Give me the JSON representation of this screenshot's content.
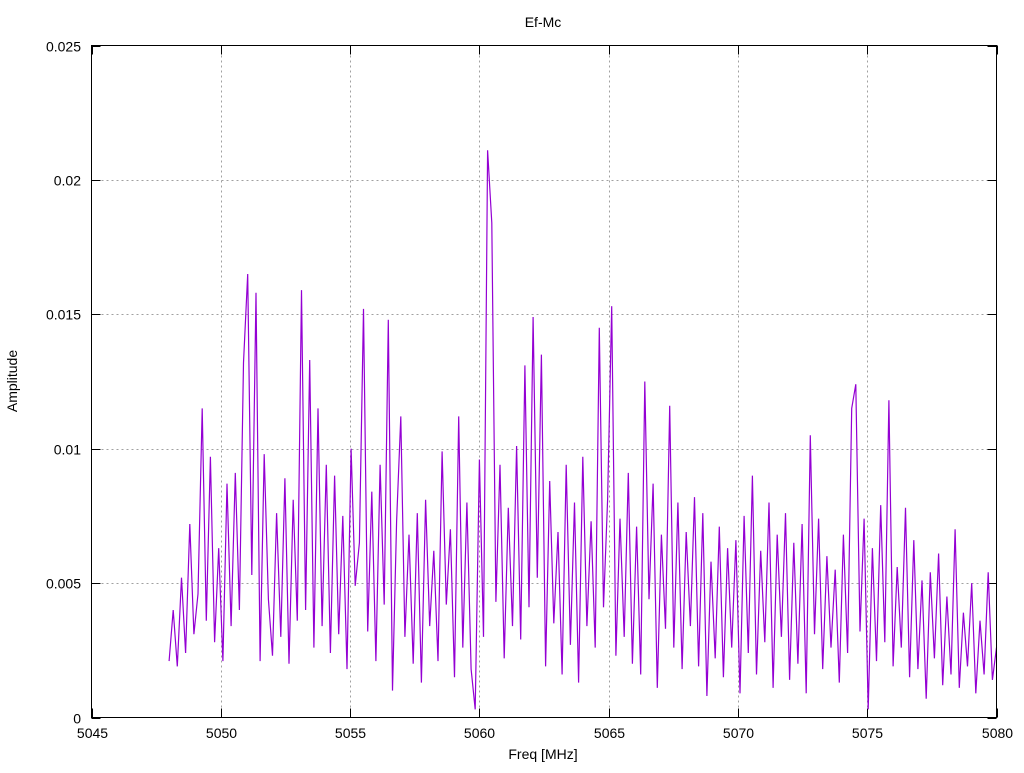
{
  "chart_data": {
    "type": "line",
    "title": "Ef-Mc",
    "xlabel": "Freq [MHz]",
    "ylabel": "Amplitude",
    "xlim": [
      5045,
      5080
    ],
    "ylim": [
      0,
      0.025
    ],
    "xticks": [
      5045,
      5050,
      5055,
      5060,
      5065,
      5070,
      5075,
      5080
    ],
    "yticks": [
      0,
      0.005,
      0.01,
      0.015,
      0.02,
      0.025
    ],
    "xtick_labels": [
      "5045",
      "5050",
      "5055",
      "5060",
      "5065",
      "5070",
      "5075",
      "5080"
    ],
    "ytick_labels": [
      "0",
      "0.005",
      "0.01",
      "0.015",
      "0.02",
      "0.025"
    ],
    "grid": true,
    "legend": "none",
    "series": [
      {
        "name": "Ef-Mc",
        "color": "#9400d3",
        "x_start": 5048.0,
        "x_step": 0.16,
        "value_multiplier": 0.001,
        "values": [
          2.1,
          4.0,
          1.9,
          5.2,
          2.4,
          7.2,
          3.1,
          4.6,
          11.5,
          3.6,
          9.7,
          2.8,
          6.3,
          2.1,
          8.7,
          3.4,
          9.1,
          4.0,
          13.2,
          16.5,
          5.3,
          15.8,
          2.1,
          9.8,
          4.4,
          2.3,
          7.6,
          3.0,
          8.9,
          2.0,
          8.1,
          3.6,
          15.9,
          4.0,
          13.3,
          2.6,
          11.5,
          3.4,
          9.4,
          2.4,
          9.0,
          3.1,
          7.5,
          1.8,
          10.0,
          4.9,
          6.5,
          15.2,
          3.2,
          8.4,
          2.1,
          9.4,
          4.2,
          14.8,
          1.0,
          7.3,
          11.2,
          3.0,
          6.8,
          2.0,
          7.6,
          1.3,
          8.1,
          3.4,
          6.2,
          2.1,
          9.9,
          4.2,
          7.0,
          1.5,
          11.2,
          2.6,
          8.0,
          1.8,
          0.3,
          9.6,
          3.0,
          21.1,
          18.4,
          4.3,
          9.4,
          2.2,
          7.8,
          3.4,
          10.1,
          2.9,
          13.1,
          4.1,
          14.9,
          5.2,
          13.5,
          1.9,
          8.8,
          3.5,
          6.9,
          1.6,
          9.4,
          2.7,
          8.0,
          1.3,
          9.7,
          3.4,
          7.3,
          2.6,
          14.5,
          4.1,
          8.1,
          15.3,
          2.3,
          7.4,
          3.0,
          9.1,
          2.0,
          7.1,
          1.6,
          12.5,
          4.4,
          8.7,
          1.1,
          6.8,
          3.3,
          11.6,
          2.6,
          8.0,
          1.8,
          6.9,
          3.4,
          8.2,
          1.9,
          7.6,
          0.8,
          5.8,
          2.2,
          7.1,
          1.5,
          6.3,
          2.6,
          6.6,
          0.9,
          7.5,
          2.4,
          9.0,
          1.6,
          6.2,
          2.8,
          8.0,
          1.1,
          6.8,
          3.0,
          7.6,
          1.4,
          6.5,
          2.0,
          7.2,
          0.9,
          10.5,
          3.1,
          7.4,
          1.8,
          6.0,
          2.6,
          5.5,
          1.3,
          6.8,
          2.4,
          11.5,
          12.4,
          3.2,
          7.4,
          0.3,
          6.3,
          2.1,
          7.9,
          2.8,
          11.8,
          1.9,
          5.6,
          2.6,
          7.8,
          1.5,
          6.6,
          1.8,
          5.1,
          0.7,
          5.4,
          2.2,
          6.1,
          1.2,
          4.5,
          1.6,
          7.0,
          1.1,
          3.9,
          1.9,
          5.0,
          0.9,
          3.6,
          1.6,
          5.4,
          1.4,
          2.6
        ]
      }
    ]
  }
}
